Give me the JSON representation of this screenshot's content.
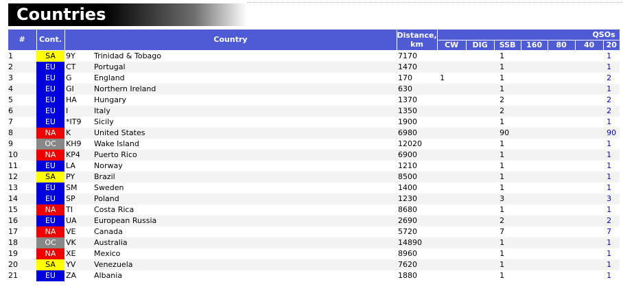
{
  "page": {
    "title": "Countries"
  },
  "table": {
    "headers": {
      "num": "#",
      "cont": "Cont.",
      "country": "Country",
      "distance_line1": "Distance,",
      "distance_line2": "km",
      "qsos": "QSOs",
      "cw": "CW",
      "dig": "DIG",
      "ssb": "SSB",
      "b160": "160",
      "b80": "80",
      "b40": "40",
      "b20": "20"
    },
    "rows": [
      {
        "num": "1",
        "cont": "SA",
        "prefix": "9Y",
        "country": "Trinidad & Tobago",
        "distance": "7170",
        "cw": "",
        "dig": "",
        "ssb": "1",
        "b160": "",
        "b80": "",
        "b40": "",
        "b20": "1"
      },
      {
        "num": "2",
        "cont": "EU",
        "prefix": "CT",
        "country": "Portugal",
        "distance": "1470",
        "cw": "",
        "dig": "",
        "ssb": "1",
        "b160": "",
        "b80": "",
        "b40": "",
        "b20": "1"
      },
      {
        "num": "3",
        "cont": "EU",
        "prefix": "G",
        "country": "England",
        "distance": "170",
        "cw": "1",
        "dig": "",
        "ssb": "1",
        "b160": "",
        "b80": "",
        "b40": "",
        "b20": "2"
      },
      {
        "num": "4",
        "cont": "EU",
        "prefix": "GI",
        "country": "Northern Ireland",
        "distance": "630",
        "cw": "",
        "dig": "",
        "ssb": "1",
        "b160": "",
        "b80": "",
        "b40": "",
        "b20": "1"
      },
      {
        "num": "5",
        "cont": "EU",
        "prefix": "HA",
        "country": "Hungary",
        "distance": "1370",
        "cw": "",
        "dig": "",
        "ssb": "2",
        "b160": "",
        "b80": "",
        "b40": "",
        "b20": "2"
      },
      {
        "num": "6",
        "cont": "EU",
        "prefix": "I",
        "country": "Italy",
        "distance": "1350",
        "cw": "",
        "dig": "",
        "ssb": "2",
        "b160": "",
        "b80": "",
        "b40": "",
        "b20": "2"
      },
      {
        "num": "7",
        "cont": "EU",
        "prefix": "*IT9",
        "country": "Sicily",
        "distance": "1900",
        "cw": "",
        "dig": "",
        "ssb": "1",
        "b160": "",
        "b80": "",
        "b40": "",
        "b20": "1"
      },
      {
        "num": "8",
        "cont": "NA",
        "prefix": "K",
        "country": "United States",
        "distance": "6980",
        "cw": "",
        "dig": "",
        "ssb": "90",
        "b160": "",
        "b80": "",
        "b40": "",
        "b20": "90"
      },
      {
        "num": "9",
        "cont": "OC",
        "prefix": "KH9",
        "country": "Wake Island",
        "distance": "12020",
        "cw": "",
        "dig": "",
        "ssb": "1",
        "b160": "",
        "b80": "",
        "b40": "",
        "b20": "1"
      },
      {
        "num": "10",
        "cont": "NA",
        "prefix": "KP4",
        "country": "Puerto Rico",
        "distance": "6900",
        "cw": "",
        "dig": "",
        "ssb": "1",
        "b160": "",
        "b80": "",
        "b40": "",
        "b20": "1"
      },
      {
        "num": "11",
        "cont": "EU",
        "prefix": "LA",
        "country": "Norway",
        "distance": "1210",
        "cw": "",
        "dig": "",
        "ssb": "1",
        "b160": "",
        "b80": "",
        "b40": "",
        "b20": "1"
      },
      {
        "num": "12",
        "cont": "SA",
        "prefix": "PY",
        "country": "Brazil",
        "distance": "8500",
        "cw": "",
        "dig": "",
        "ssb": "1",
        "b160": "",
        "b80": "",
        "b40": "",
        "b20": "1"
      },
      {
        "num": "13",
        "cont": "EU",
        "prefix": "SM",
        "country": "Sweden",
        "distance": "1400",
        "cw": "",
        "dig": "",
        "ssb": "1",
        "b160": "",
        "b80": "",
        "b40": "",
        "b20": "1"
      },
      {
        "num": "14",
        "cont": "EU",
        "prefix": "SP",
        "country": "Poland",
        "distance": "1230",
        "cw": "",
        "dig": "",
        "ssb": "3",
        "b160": "",
        "b80": "",
        "b40": "",
        "b20": "3"
      },
      {
        "num": "15",
        "cont": "NA",
        "prefix": "TI",
        "country": "Costa Rica",
        "distance": "8680",
        "cw": "",
        "dig": "",
        "ssb": "1",
        "b160": "",
        "b80": "",
        "b40": "",
        "b20": "1"
      },
      {
        "num": "16",
        "cont": "EU",
        "prefix": "UA",
        "country": "European Russia",
        "distance": "2690",
        "cw": "",
        "dig": "",
        "ssb": "2",
        "b160": "",
        "b80": "",
        "b40": "",
        "b20": "2"
      },
      {
        "num": "17",
        "cont": "NA",
        "prefix": "VE",
        "country": "Canada",
        "distance": "5720",
        "cw": "",
        "dig": "",
        "ssb": "7",
        "b160": "",
        "b80": "",
        "b40": "",
        "b20": "7"
      },
      {
        "num": "18",
        "cont": "OC",
        "prefix": "VK",
        "country": "Australia",
        "distance": "14890",
        "cw": "",
        "dig": "",
        "ssb": "1",
        "b160": "",
        "b80": "",
        "b40": "",
        "b20": "1"
      },
      {
        "num": "19",
        "cont": "NA",
        "prefix": "XE",
        "country": "Mexico",
        "distance": "8960",
        "cw": "",
        "dig": "",
        "ssb": "1",
        "b160": "",
        "b80": "",
        "b40": "",
        "b20": "1"
      },
      {
        "num": "20",
        "cont": "SA",
        "prefix": "YV",
        "country": "Venezuela",
        "distance": "7620",
        "cw": "",
        "dig": "",
        "ssb": "1",
        "b160": "",
        "b80": "",
        "b40": "",
        "b20": "1"
      },
      {
        "num": "21",
        "cont": "EU",
        "prefix": "ZA",
        "country": "Albania",
        "distance": "1880",
        "cw": "",
        "dig": "",
        "ssb": "1",
        "b160": "",
        "b80": "",
        "b40": "",
        "b20": "1"
      }
    ]
  },
  "colors": {
    "header_bg": "#4f5bd5",
    "SA": "#ffff00",
    "EU": "#0000dd",
    "NA": "#ee0000",
    "OC": "#888888",
    "band_value": "#0000cc"
  }
}
